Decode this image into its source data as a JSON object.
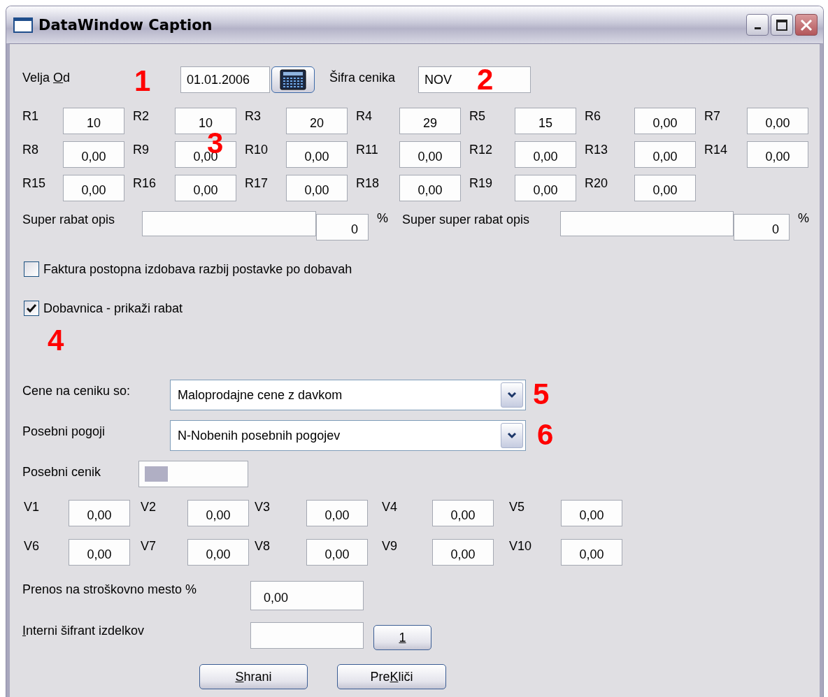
{
  "window": {
    "title": "DataWindow Caption"
  },
  "velja_od": {
    "label": {
      "before": "Velja ",
      "key": "O",
      "after": "d"
    },
    "marker": "1",
    "value": "01.01.2006"
  },
  "sifra_cenika": {
    "label": "Šifra cenika",
    "value": "NOV",
    "marker": "2"
  },
  "rabats": {
    "marker": "3",
    "items": [
      {
        "label": "R1",
        "value": "10"
      },
      {
        "label": "R2",
        "value": "10"
      },
      {
        "label": "R3",
        "value": "20"
      },
      {
        "label": "R4",
        "value": "29"
      },
      {
        "label": "R5",
        "value": "15"
      },
      {
        "label": "R6",
        "value": "0,00"
      },
      {
        "label": "R7",
        "value": "0,00"
      },
      {
        "label": "R8",
        "value": "0,00"
      },
      {
        "label": "R9",
        "value": "0,00"
      },
      {
        "label": "R10",
        "value": "0,00"
      },
      {
        "label": "R11",
        "value": "0,00"
      },
      {
        "label": "R12",
        "value": "0,00"
      },
      {
        "label": "R13",
        "value": "0,00"
      },
      {
        "label": "R14",
        "value": "0,00"
      },
      {
        "label": "R15",
        "value": "0,00"
      },
      {
        "label": "R16",
        "value": "0,00"
      },
      {
        "label": "R17",
        "value": "0,00"
      },
      {
        "label": "R18",
        "value": "0,00"
      },
      {
        "label": "R19",
        "value": "0,00"
      },
      {
        "label": "R20",
        "value": "0,00"
      }
    ]
  },
  "super_rabats": [
    {
      "label": "Super rabat opis",
      "percent": "0",
      "unit": "%"
    },
    {
      "label": "Super super rabat opis",
      "percent": "0",
      "unit": "%"
    }
  ],
  "checkboxes": [
    {
      "label": "Faktura postopna izdobava razbij postavke po dobavah",
      "checked": false
    },
    {
      "label": "Dobavnica - prikaži rabat",
      "checked": true
    }
  ],
  "checkbox_marker": "4",
  "combos": [
    {
      "label": "Cene na ceniku so:",
      "value": "Maloprodajne cene z davkom",
      "marker": "5"
    },
    {
      "label": "Posebni pogoji",
      "value": "N-Nobenih posebnih pogojev",
      "marker": "6"
    }
  ],
  "posebni_cenik": {
    "label": "Posebni cenik"
  },
  "v_values": [
    {
      "label": "V1",
      "value": "0,00"
    },
    {
      "label": "V2",
      "value": "0,00"
    },
    {
      "label": "V3",
      "value": "0,00"
    },
    {
      "label": "V4",
      "value": "0,00"
    },
    {
      "label": "V5",
      "value": "0,00"
    },
    {
      "label": "V6",
      "value": "0,00"
    },
    {
      "label": "V7",
      "value": "0,00"
    },
    {
      "label": "V8",
      "value": "0,00"
    },
    {
      "label": "V9",
      "value": "0,00"
    },
    {
      "label": "V10",
      "value": "0,00"
    }
  ],
  "prenos": {
    "label": "Prenos na stroškovno mesto %",
    "value": "0,00"
  },
  "interni": {
    "label": {
      "key": "I",
      "after": "nterni šifrant izdelkov"
    },
    "button": {
      "key": "1"
    }
  },
  "buttons": [
    {
      "key": "S",
      "after": "hrani"
    },
    {
      "before": "Pre",
      "key": "K",
      "after": "liči"
    }
  ]
}
